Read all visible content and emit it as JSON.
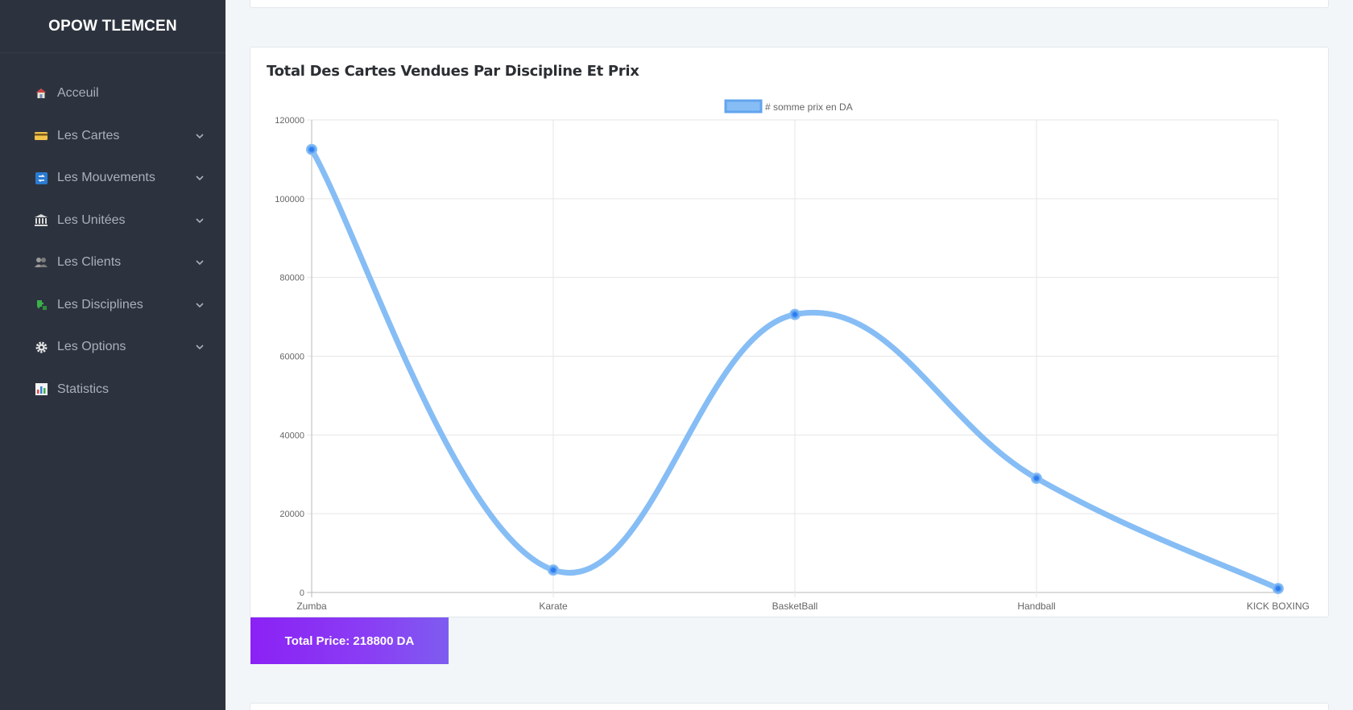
{
  "sidebar": {
    "brand": "OPOW TLEMCEN",
    "items": [
      {
        "label": "Acceuil",
        "icon": "home-icon",
        "has_chevron": false
      },
      {
        "label": " Les Cartes",
        "icon": "card-icon",
        "has_chevron": true
      },
      {
        "label": "Les Mouvements",
        "icon": "transfer-icon",
        "has_chevron": true
      },
      {
        "label": "Les Unitées",
        "icon": "building-icon",
        "has_chevron": true
      },
      {
        "label": "Les Clients",
        "icon": "users-icon",
        "has_chevron": true
      },
      {
        "label": "Les Disciplines",
        "icon": "puzzle-icon",
        "has_chevron": true
      },
      {
        "label": "Les Options",
        "icon": "gear-icon",
        "has_chevron": true
      },
      {
        "label": "Statistics",
        "icon": "bar-chart-icon",
        "has_chevron": false
      }
    ]
  },
  "main": {
    "chart_card_title": "Total Des Cartes Vendues Par Discipline Et Prix",
    "total_price": "Total Price: 218800 DA"
  },
  "colors": {
    "sidebar_bg": "#2d333e",
    "line": "#86bdf5",
    "point": "#2d7cf0",
    "total_gradient_start": "#8b21f5",
    "total_gradient_end": "#7e5cf0"
  },
  "chart_data": {
    "type": "line",
    "title": "",
    "categories": [
      "Zumba",
      "Karate",
      "BasketBall",
      "Handball",
      "KICK BOXING"
    ],
    "series": [
      {
        "name": "# somme prix en DA",
        "values": [
          112500,
          5700,
          70600,
          29000,
          1000
        ]
      }
    ],
    "ylim": [
      0,
      120000
    ],
    "yticks": [
      0,
      20000,
      40000,
      60000,
      80000,
      100000,
      120000
    ],
    "legend_position": "top-center",
    "grid": true,
    "curve": "smooth"
  }
}
